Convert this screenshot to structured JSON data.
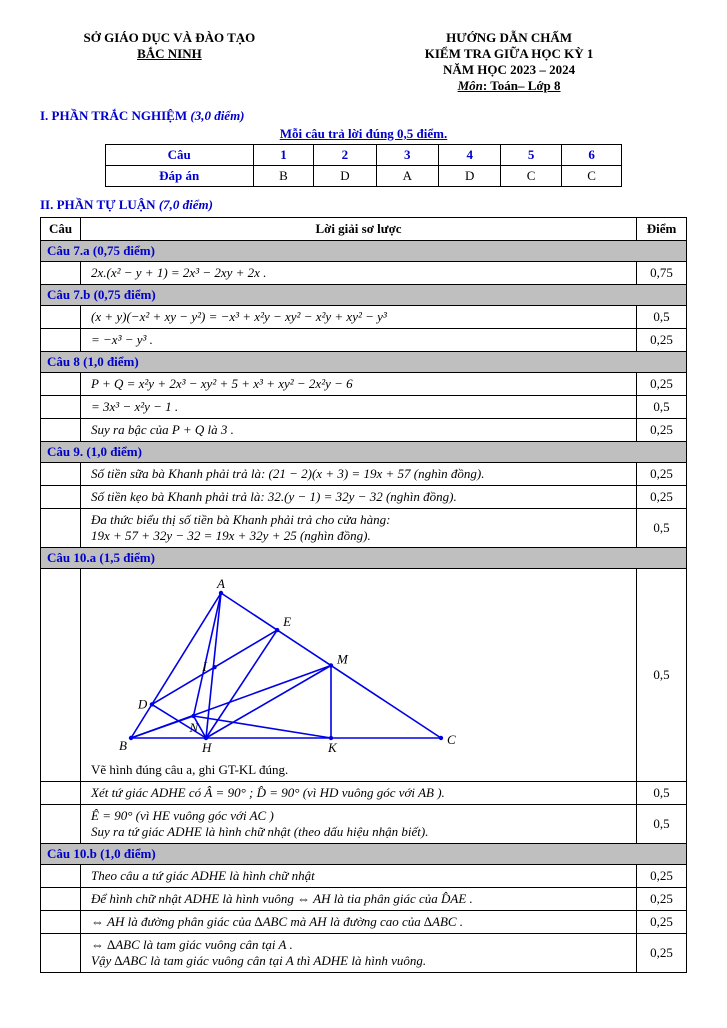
{
  "header": {
    "left_line1": "SỞ GIÁO DỤC VÀ ĐÀO TẠO",
    "left_line2": "BẮC NINH",
    "right_line1": "HƯỚNG DẪN CHẤM",
    "right_line2": "KIỂM TRA GIỮA HỌC KỲ 1",
    "right_line3": "NĂM HỌC 2023 – 2024",
    "right_line4_label": "Môn",
    "right_line4_value": ": Toán– Lớp 8"
  },
  "section1": {
    "title": "I. PHẦN TRẮC NGHIỆM",
    "points": "(3,0 điểm)",
    "note": "Mỗi câu trả lời đúng 0,5 điểm.",
    "row_q": "Câu",
    "row_a": "Đáp án",
    "cols": [
      "1",
      "2",
      "3",
      "4",
      "5",
      "6"
    ],
    "answers": [
      "B",
      "D",
      "A",
      "D",
      "C",
      "C"
    ]
  },
  "section2": {
    "title": "II. PHẦN TỰ LUẬN",
    "points": "(7,0 điểm)",
    "head_q": "Câu",
    "head_sol": "Lời giải sơ lược",
    "head_pt": "Điểm",
    "rows": [
      {
        "type": "sec",
        "text": "Câu 7.a (0,75 điểm)"
      },
      {
        "type": "line",
        "text": "2x.(x² − y + 1) = 2x³ − 2xy + 2x .",
        "pt": "0,75"
      },
      {
        "type": "sec",
        "text": "Câu 7.b (0,75 điểm)"
      },
      {
        "type": "line",
        "text": "(x + y)(−x² + xy − y²) = −x³ + x²y − xy² − x²y + xy² − y³",
        "pt": "0,5"
      },
      {
        "type": "line",
        "text": "= −x³ − y³ .",
        "pt": "0,25"
      },
      {
        "type": "sec",
        "text": "Câu 8 (1,0 điểm)"
      },
      {
        "type": "line",
        "text": "P + Q = x²y + 2x³ − xy² + 5 + x³ + xy² − 2x²y − 6",
        "pt": "0,25"
      },
      {
        "type": "line",
        "text": "= 3x³ − x²y − 1 .",
        "pt": "0,5"
      },
      {
        "type": "line",
        "text": "Suy ra bậc của  P + Q  là 3 .",
        "pt": "0,25"
      },
      {
        "type": "sec",
        "text": "Câu 9. (1,0 điểm)"
      },
      {
        "type": "line",
        "text": "Số tiền sữa bà Khanh phải trả là: (21 − 2)(x + 3) = 19x + 57  (nghìn đồng).",
        "pt": "0,25"
      },
      {
        "type": "line",
        "text": "Số tiền kẹo bà Khanh phải trả là: 32.(y − 1) = 32y − 32  (nghìn đồng).",
        "pt": "0,25"
      },
      {
        "type": "line2",
        "text1": "Đa thức biểu thị số tiền bà Khanh phải trả cho cửa hàng:",
        "text2": "19x + 57 + 32y − 32 = 19x + 32y + 25  (nghìn đồng).",
        "pt": "0,5"
      },
      {
        "type": "sec",
        "text": "Câu 10.a  (1,5 điểm)"
      },
      {
        "type": "geom",
        "caption": "Vẽ hình đúng câu a, ghi GT-KL đúng.",
        "pt": "0,5"
      },
      {
        "type": "line",
        "text": "Xét tứ giác  ADHE  có  Â = 90° ;  D̂ = 90°  (vì HD vuông góc với  AB ).",
        "pt": "0,5"
      },
      {
        "type": "line2",
        "text1": "Ê = 90°  (vì HE vuông góc với  AC )",
        "text2": "Suy ra tứ giác  ADHE  là  hình chữ nhật (theo dấu hiệu nhận biết).",
        "pt": "0,5"
      },
      {
        "type": "sec",
        "text": "Câu 10.b (1,0 điểm)"
      },
      {
        "type": "line",
        "text": "Theo câu a tứ giác  ADHE  là hình chữ nhật",
        "pt": "0,25"
      },
      {
        "type": "line",
        "text": "Để hình chữ nhật  ADHE  là hình vuông ⇔ AH là tia phân giác của  D̂AE .",
        "pt": "0,25"
      },
      {
        "type": "line",
        "text": "⇔ AH  là đường phân giác của ∆ABC  mà  AH là đường cao của ∆ABC .",
        "pt": "0,25"
      },
      {
        "type": "line2",
        "text1": "⇔ ∆ABC là tam giác vuông cân tại  A .",
        "text2": "Vậy ∆ABC  là tam giác vuông cân tại  A  thì  ADHE  là hình vuông.",
        "pt": "0,25"
      }
    ]
  },
  "geometry": {
    "labels": {
      "A": "A",
      "B": "B",
      "C": "C",
      "D": "D",
      "E": "E",
      "H": "H",
      "I": "I",
      "K": "K",
      "M": "M",
      "N": "N"
    }
  }
}
